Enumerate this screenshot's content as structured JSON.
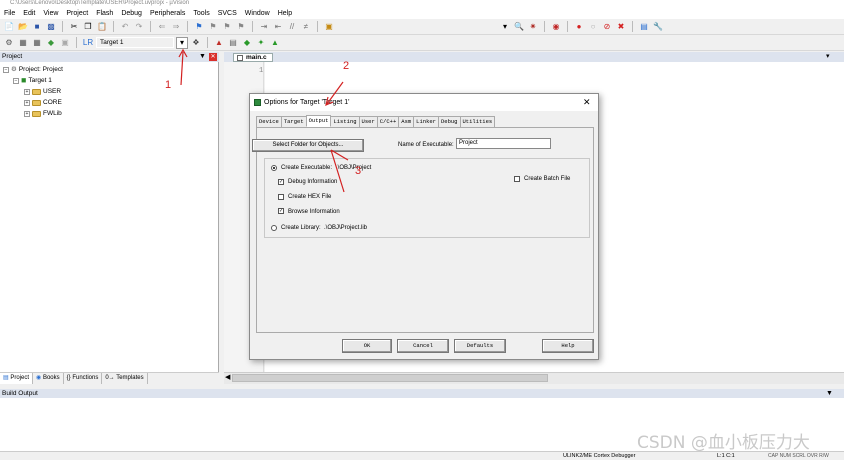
{
  "window": {
    "title": "C:\\Users\\Lenovo\\Desktop\\Template\\USER\\Project.uvprojx - µVision"
  },
  "menu": [
    "File",
    "Edit",
    "View",
    "Project",
    "Flash",
    "Debug",
    "Peripherals",
    "Tools",
    "SVCS",
    "Window",
    "Help"
  ],
  "toolbar2": {
    "target": "Target 1"
  },
  "project_panel": {
    "header": "Project",
    "root": "Project: Project",
    "target": "Target 1",
    "groups": [
      "USER",
      "CORE",
      "FWLib"
    ],
    "tabs": [
      "Project",
      "Books",
      "{} Functions",
      "0→ Templates"
    ]
  },
  "editor": {
    "tab": "main.c",
    "line_number": "1"
  },
  "build_output": {
    "header": "Build Output"
  },
  "status": {
    "debugger": "ULINK2/ME Cortex Debugger",
    "position": "L:1 C:1",
    "keys": "CAP NUM SCRL OVR R/W"
  },
  "watermark": "CSDN @血小板压力大",
  "dialog": {
    "title": "Options for Target 'Target 1'",
    "tabs": [
      "Device",
      "Target",
      "Output",
      "Listing",
      "User",
      "C/C++",
      "Asm",
      "Linker",
      "Debug",
      "Utilities"
    ],
    "active_tab": "Output",
    "select_folder_label": "Select Folder for Objects...",
    "name_of_executable_label": "Name of Executable:",
    "name_of_executable_value": "Project",
    "create_executable_label": "Create Executable:",
    "create_executable_path": ".\\OBJ\\Project",
    "debug_information_label": "Debug Information",
    "debug_information_checked": true,
    "create_hex_label": "Create HEX File",
    "create_hex_checked": false,
    "browse_information_label": "Browse Information",
    "browse_information_checked": true,
    "create_batch_label": "Create Batch File",
    "create_batch_checked": false,
    "create_library_label": "Create Library:",
    "create_library_path": ".\\OBJ\\Project.lib",
    "buttons": {
      "ok": "OK",
      "cancel": "Cancel",
      "defaults": "Defaults",
      "help": "Help"
    }
  },
  "annotations": [
    "1",
    "2",
    "3"
  ],
  "colors": {
    "annotation": "#d32020",
    "panel_header": "#dde3ee"
  }
}
